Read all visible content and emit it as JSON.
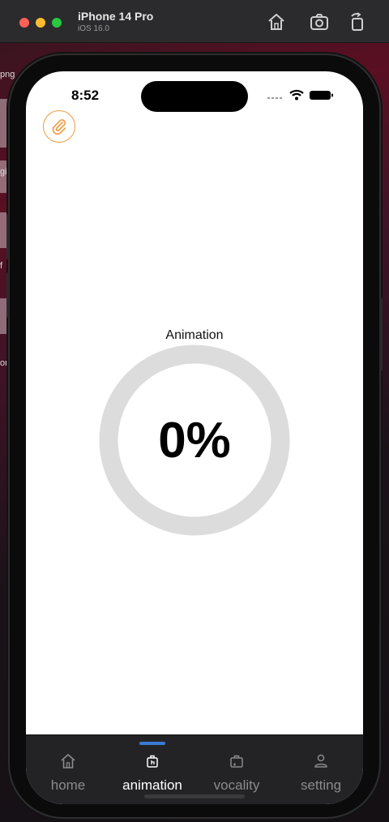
{
  "simulator": {
    "device_name": "iPhone 14 Pro",
    "os_version": "iOS 16.0",
    "toolbar_icons": [
      "home-icon",
      "screenshot-icon",
      "rotate-icon"
    ]
  },
  "background_fragments": [
    "png",
    "gi",
    "f",
    "or"
  ],
  "status_bar": {
    "time": "8:52",
    "icons": [
      "signal-icon",
      "wifi-icon",
      "battery-icon"
    ]
  },
  "fab": {
    "icon": "paperclip-icon",
    "color": "#f19a3e"
  },
  "progress": {
    "label": "Animation",
    "value_text": "0%",
    "value": 0,
    "track_color": "#dcdcdc",
    "fill_color": "#3a7bd5"
  },
  "tab_bar": {
    "active_index": 1,
    "indicator_color": "#3a7bd5",
    "tabs": [
      {
        "label": "home",
        "icon": "home-icon"
      },
      {
        "label": "animation",
        "icon": "hand-pointer-icon"
      },
      {
        "label": "vocality",
        "icon": "suitcase-plus-icon"
      },
      {
        "label": "setting",
        "icon": "person-icon"
      }
    ]
  }
}
